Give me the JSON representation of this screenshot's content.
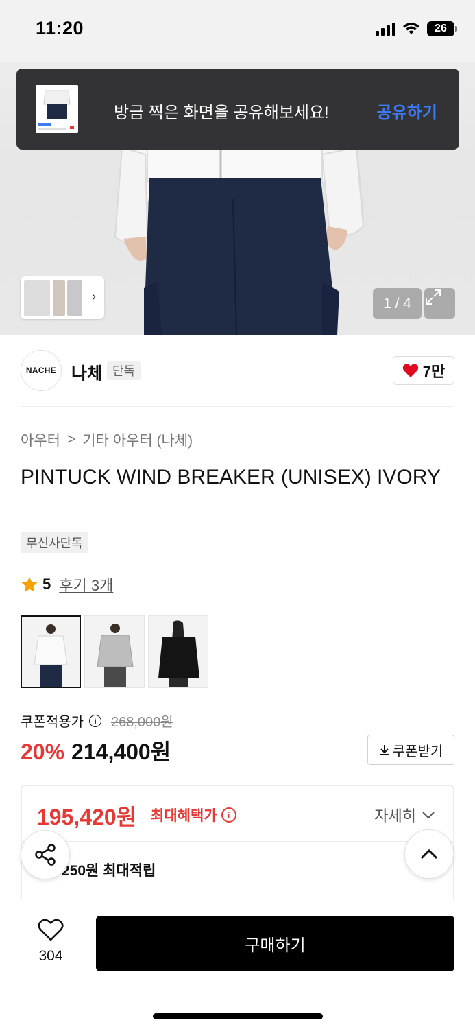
{
  "status_bar": {
    "time": "11:20",
    "battery": "26"
  },
  "toast": {
    "message": "방금 찍은 화면을 공유해보세요!",
    "action": "공유하기"
  },
  "gallery": {
    "page_indicator": "1 / 4"
  },
  "brand": {
    "logo_text": "NACHE",
    "name": "나체",
    "tag": "단독",
    "likes": "7만"
  },
  "breadcrumb": {
    "level1": "아우터",
    "separator": ">",
    "level2": "기타 아우터 (나체)"
  },
  "product": {
    "title": "PINTUCK WIND BREAKER (UNISEX) IVORY",
    "exclusive_tag": "무신사단독",
    "rating": "5",
    "reviews": "후기 3개",
    "variants": [
      "ivory",
      "gray",
      "black"
    ]
  },
  "price": {
    "label": "쿠폰적용가",
    "original": "268,000원",
    "discount": "20%",
    "sale": "214,400원",
    "coupon_button": "쿠폰받기"
  },
  "benefit": {
    "max_price": "195,420원",
    "max_label": "최대혜택가",
    "details": "자세히",
    "points": "250원 최대적립"
  },
  "bottom": {
    "wish_count": "304",
    "buy_label": "구매하기"
  },
  "colors": {
    "accent_red": "#e53935",
    "share_blue": "#3d7bf7",
    "buy_black": "#000000"
  }
}
